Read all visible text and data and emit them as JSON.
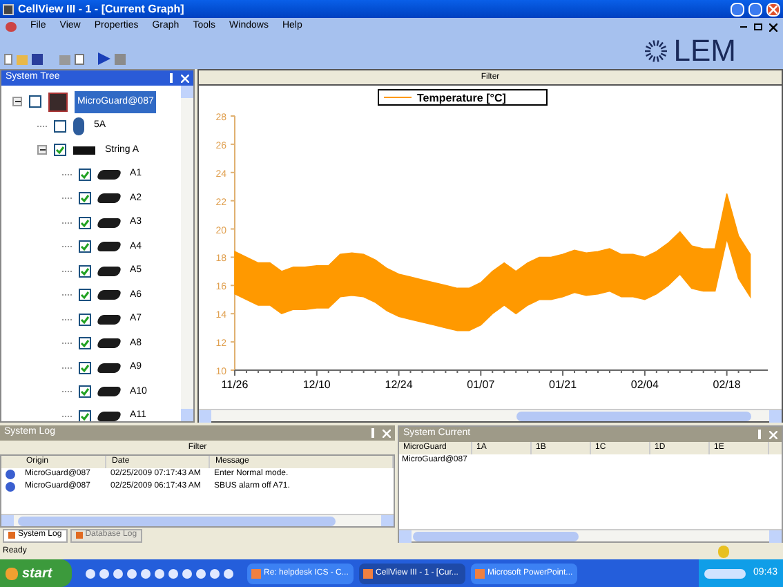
{
  "window": {
    "title": "CellView III - 1 - [Current Graph]"
  },
  "menu": [
    "File",
    "View",
    "Properties",
    "Graph",
    "Tools",
    "Windows",
    "Help"
  ],
  "logo": "LEM",
  "system_tree": {
    "title": "System Tree",
    "items": [
      {
        "label": "MicroGuard@087",
        "kind": "controller",
        "checked": false,
        "selected": true,
        "expanded": true,
        "children": [
          {
            "label": "5A",
            "kind": "sensor",
            "checked": false,
            "selected": false
          },
          {
            "label": "String A",
            "kind": "string",
            "checked": true,
            "selected": false,
            "expanded": true,
            "children": [
              {
                "label": "A1",
                "kind": "cell",
                "checked": true,
                "selected": false
              },
              {
                "label": "A2",
                "kind": "cell",
                "checked": true,
                "selected": false
              },
              {
                "label": "A3",
                "kind": "cell",
                "checked": true,
                "selected": false
              },
              {
                "label": "A4",
                "kind": "cell",
                "checked": true,
                "selected": false
              },
              {
                "label": "A5",
                "kind": "cell",
                "checked": true,
                "selected": false
              },
              {
                "label": "A6",
                "kind": "cell",
                "checked": true,
                "selected": false
              },
              {
                "label": "A7",
                "kind": "cell",
                "checked": true,
                "selected": false
              },
              {
                "label": "A8",
                "kind": "cell",
                "checked": true,
                "selected": false
              },
              {
                "label": "A9",
                "kind": "cell",
                "checked": true,
                "selected": false
              },
              {
                "label": "A10",
                "kind": "cell",
                "checked": true,
                "selected": false
              },
              {
                "label": "A11",
                "kind": "cell",
                "checked": true,
                "selected": false
              }
            ]
          }
        ]
      }
    ]
  },
  "graph": {
    "filter": "Filter",
    "chart_data": {
      "type": "area",
      "categories": [
        "11/26",
        null,
        null,
        null,
        null,
        null,
        null,
        "12/10",
        null,
        null,
        null,
        null,
        null,
        null,
        "12/24",
        null,
        null,
        null,
        null,
        null,
        null,
        "01/07",
        null,
        null,
        null,
        null,
        null,
        null,
        "01/21",
        null,
        null,
        null,
        null,
        null,
        null,
        "02/04",
        null,
        null,
        null,
        null,
        null,
        null,
        "02/18",
        null,
        null
      ],
      "series": [
        {
          "name": "Temperature [°C]",
          "color": "#ff9900",
          "values": [
            18.4,
            18,
            17.6,
            17.6,
            17,
            17.3,
            17.3,
            17.4,
            17.4,
            18.2,
            18.3,
            18.2,
            17.8,
            17.2,
            16.8,
            16.6,
            16.4,
            16.2,
            16,
            15.8,
            15.8,
            16.2,
            17,
            17.6,
            17,
            17.6,
            18,
            18,
            18.2,
            18.5,
            18.3,
            18.4,
            18.6,
            18.2,
            18.2,
            18,
            18.4,
            19,
            19.8,
            18.8,
            18.6,
            18.6,
            22.5,
            19.5,
            18.2
          ]
        }
      ],
      "ylim": [
        10,
        28
      ],
      "yticks": [
        10,
        12,
        14,
        16,
        18,
        20,
        22,
        24,
        26,
        28
      ]
    }
  },
  "system_log": {
    "title": "System Log",
    "filter": "Filter",
    "columns": [
      "Origin",
      "Date",
      "Message"
    ],
    "rows": [
      [
        "MicroGuard@087",
        "02/25/2009 07:17:43 AM",
        "Enter Normal mode."
      ],
      [
        "MicroGuard@087",
        "02/25/2009 06:17:43 AM",
        "SBUS alarm off A71."
      ]
    ],
    "tabs": [
      {
        "label": "System Log",
        "selected": true
      },
      {
        "label": "Database Log",
        "selected": false
      }
    ]
  },
  "system_current": {
    "title": "System Current",
    "columns": [
      "MicroGuard",
      "1A",
      "1B",
      "1C",
      "1D",
      "1E"
    ],
    "rows": [
      [
        "MicroGuard@087"
      ]
    ]
  },
  "status_bar": {
    "text": "Ready"
  },
  "taskbar": {
    "start": "start",
    "tasks": [
      {
        "label": "Re: helpdesk ICS - C...",
        "selected": false
      },
      {
        "label": "CellView III - 1 - [Cur...",
        "selected": true
      },
      {
        "label": "Microsoft PowerPoint...",
        "selected": false
      }
    ],
    "clock": "09:43"
  }
}
